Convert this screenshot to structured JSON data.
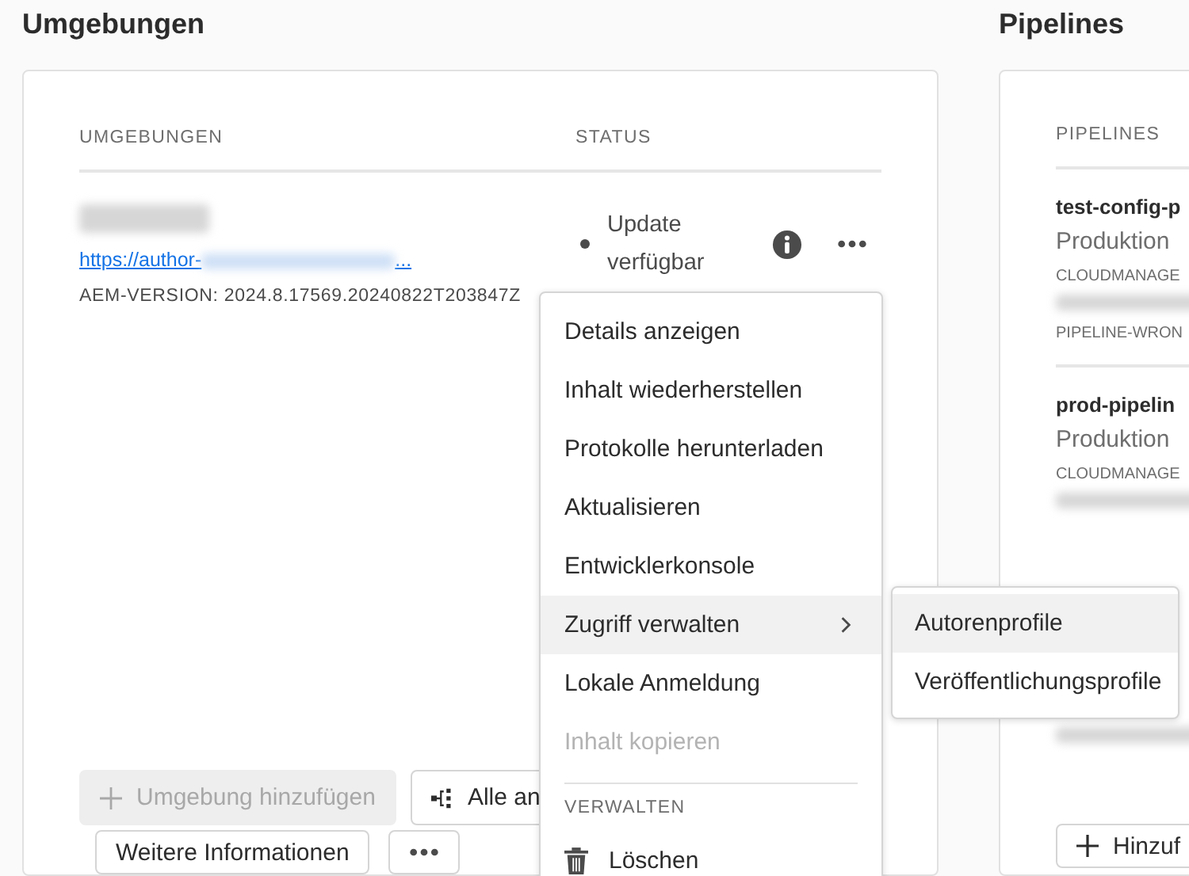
{
  "environments": {
    "title": "Umgebungen",
    "columns": [
      "UMGEBUNGEN",
      "STATUS"
    ],
    "rows": [
      {
        "link_text": "https://author-",
        "link_ellipsis": "...",
        "version": "AEM-VERSION: 2024.8.17569.20240822T203847Z",
        "status": "Update verfügbar"
      }
    ],
    "buttons": [
      {
        "kind": "add",
        "label": "Umgebung hinzufügen",
        "disabled": true
      },
      {
        "kind": "tree",
        "label": "Alle an",
        "disabled": false
      },
      {
        "kind": "text",
        "label": "Weitere Informationen",
        "disabled": false
      },
      {
        "kind": "more",
        "disabled": false
      }
    ]
  },
  "context_menu": {
    "items": [
      {
        "kind": "item",
        "label": "Details anzeigen",
        "disabled": false,
        "highlighted": false
      },
      {
        "kind": "item",
        "label": "Inhalt wiederherstellen",
        "disabled": false,
        "highlighted": false
      },
      {
        "kind": "item",
        "label": "Protokolle herunterladen",
        "disabled": false,
        "highlighted": false
      },
      {
        "kind": "item",
        "label": "Aktualisieren",
        "disabled": false,
        "highlighted": false
      },
      {
        "kind": "item",
        "label": "Entwicklerkonsole",
        "disabled": false,
        "highlighted": false
      },
      {
        "kind": "submenu",
        "label": "Zugriff verwalten",
        "disabled": false,
        "highlighted": true
      },
      {
        "kind": "item",
        "label": "Lokale Anmeldung",
        "disabled": false,
        "highlighted": false
      },
      {
        "kind": "item",
        "label": "Inhalt kopieren",
        "disabled": true,
        "highlighted": false
      },
      {
        "kind": "divider"
      },
      {
        "kind": "section",
        "label": "VERWALTEN"
      },
      {
        "kind": "delete",
        "label": "Löschen",
        "disabled": false,
        "highlighted": false
      }
    ]
  },
  "submenu": {
    "items": [
      {
        "label": "Autorenprofile",
        "highlighted": true
      },
      {
        "label": "Veröffentlichungsprofile",
        "highlighted": false
      }
    ]
  },
  "pipelines": {
    "title": "Pipelines",
    "column": "PIPELINES",
    "rows": [
      {
        "name": "test-config-p",
        "environment": "Produktion",
        "program": "CLOUDMANAGE",
        "error": "PIPELINE-WRON"
      },
      {
        "name": "prod-pipelin",
        "environment": "Produktion",
        "program": "CLOUDMANAGE"
      }
    ],
    "button": "Hinzuf"
  }
}
